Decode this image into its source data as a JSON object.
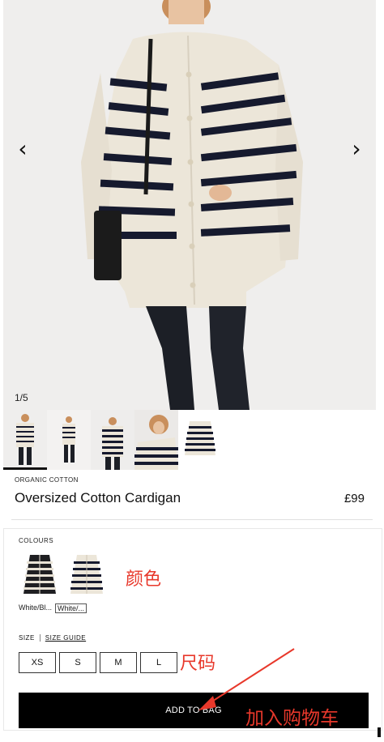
{
  "gallery": {
    "counter": "1/5",
    "prev_icon": "chevron-left-icon",
    "next_icon": "chevron-right-icon",
    "prev_glyph": "‹",
    "next_glyph": "›",
    "thumbnail_count": 5,
    "active_index": 0
  },
  "product": {
    "eyebrow": "ORGANIC COTTON",
    "name": "Oversized Cotton Cardigan",
    "price": "£99"
  },
  "colours": {
    "label": "COLOURS",
    "options": [
      {
        "name": "White/Bl...",
        "selected": false
      },
      {
        "name": "White/...",
        "selected": true
      }
    ]
  },
  "size": {
    "label": "SIZE",
    "guide_label": "SIZE GUIDE",
    "options": [
      "XS",
      "S",
      "M",
      "L"
    ]
  },
  "cta": {
    "add_label": "ADD TO BAG"
  },
  "annotations": {
    "colour": "颜色",
    "size": "尺码",
    "add_to_cart": "加入购物车",
    "color": "#e8382b"
  },
  "colors": {
    "stripe": "#161a2e",
    "knit": "#ece6d9",
    "background": "#efeeed",
    "button": "#000000"
  }
}
